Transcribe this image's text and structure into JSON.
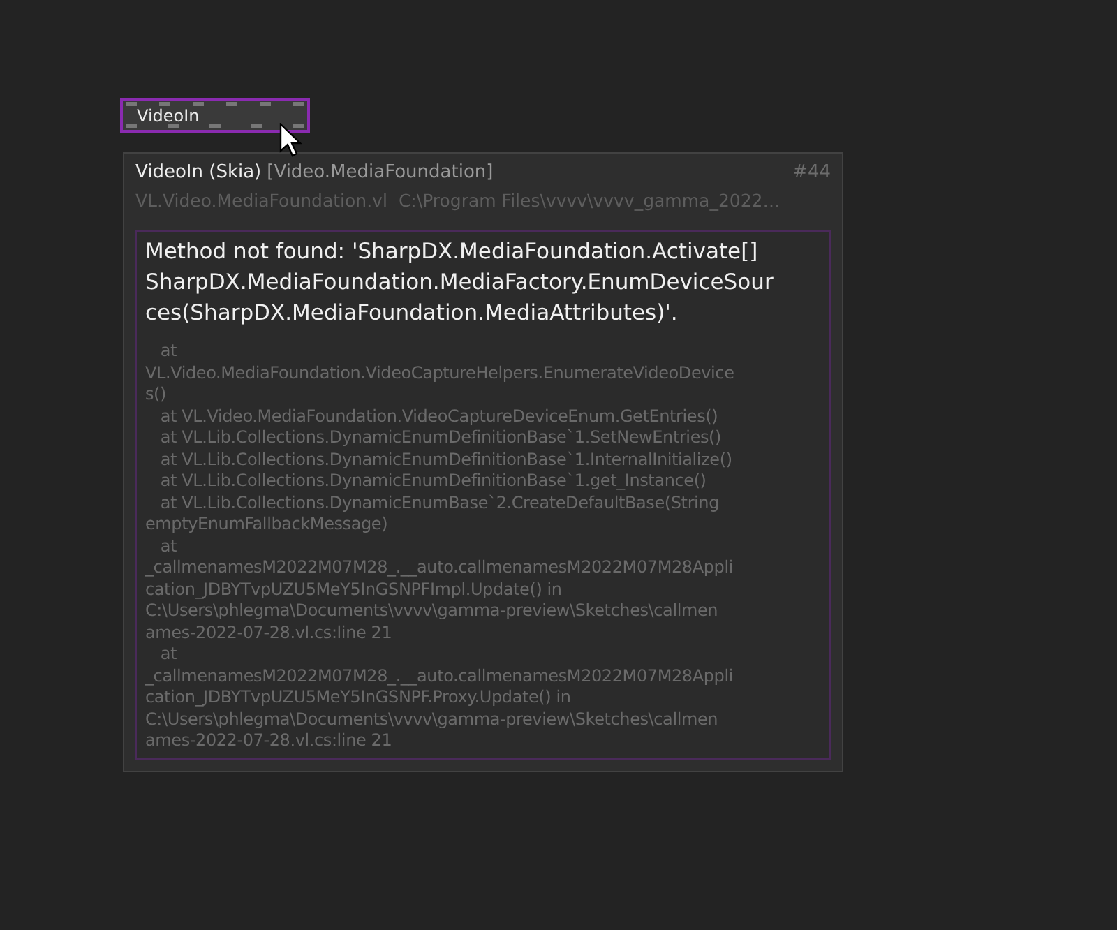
{
  "node": {
    "label": "VideoIn",
    "selected": true
  },
  "tooltip": {
    "title": "VideoIn (Skia)",
    "category": "[Video.MediaFoundation]",
    "id": "#44",
    "file": "VL.Video.MediaFoundation.vl",
    "path": "C:\\Program Files\\vvvv\\vvvv_gamma_2022…",
    "error_lines": [
      "Method not found: 'SharpDX.MediaFoundation.Activate[]",
      "SharpDX.MediaFoundation.MediaFactory.EnumDeviceSour",
      "ces(SharpDX.MediaFoundation.MediaAttributes)'."
    ],
    "stack_lines": [
      "   at",
      "VL.Video.MediaFoundation.VideoCaptureHelpers.EnumerateVideoDevice",
      "s()",
      "   at VL.Video.MediaFoundation.VideoCaptureDeviceEnum.GetEntries()",
      "   at VL.Lib.Collections.DynamicEnumDefinitionBase`1.SetNewEntries()",
      "   at VL.Lib.Collections.DynamicEnumDefinitionBase`1.InternalInitialize()",
      "   at VL.Lib.Collections.DynamicEnumDefinitionBase`1.get_Instance()",
      "   at VL.Lib.Collections.DynamicEnumBase`2.CreateDefaultBase(String",
      "emptyEnumFallbackMessage)",
      "   at",
      "_callmenamesM2022M07M28_.__auto.callmenamesM2022M07M28Appli",
      "cation_JDBYTvpUZU5MeY5InGSNPFImpl.Update() in",
      "C:\\Users\\phlegma\\Documents\\vvvv\\gamma-preview\\Sketches\\callmen",
      "ames-2022-07-28.vl.cs:line 21",
      "   at",
      "_callmenamesM2022M07M28_.__auto.callmenamesM2022M07M28Appli",
      "cation_JDBYTvpUZU5MeY5InGSNPF.Proxy.Update() in",
      "C:\\Users\\phlegma\\Documents\\vvvv\\gamma-preview\\Sketches\\callmen",
      "ames-2022-07-28.vl.cs:line 21"
    ]
  }
}
